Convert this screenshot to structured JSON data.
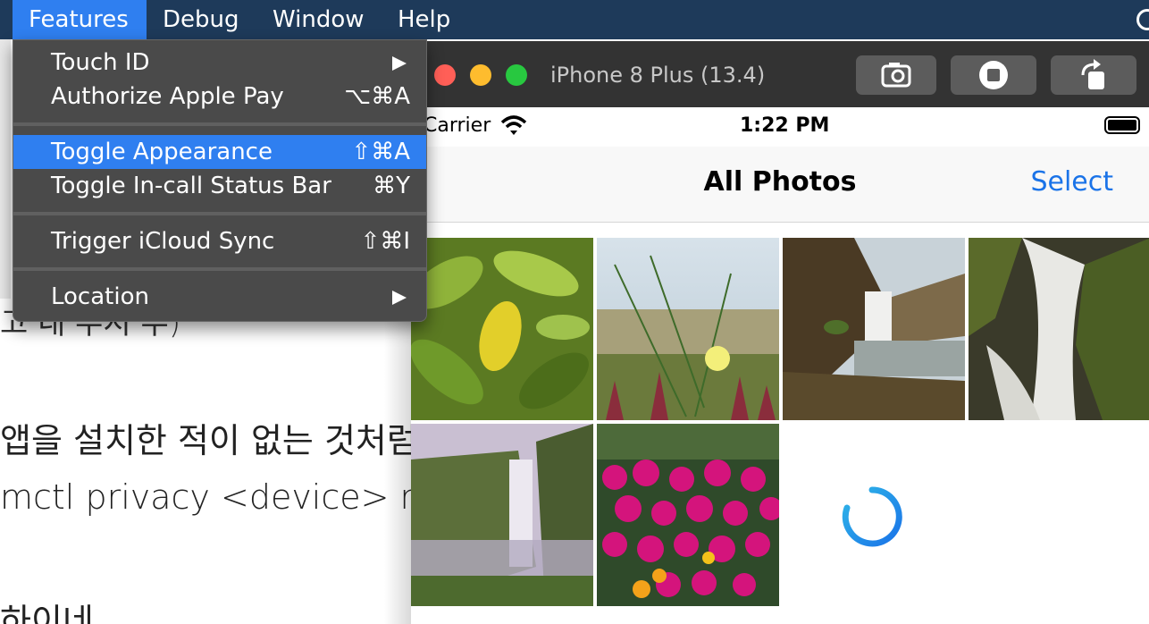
{
  "menubar": {
    "items": [
      "Features",
      "Debug",
      "Window",
      "Help"
    ]
  },
  "features_menu": {
    "items": [
      {
        "label": "Touch ID",
        "shortcut": "",
        "submenu": true
      },
      {
        "label": "Authorize Apple Pay",
        "shortcut": "⌥⌘A",
        "submenu": false
      },
      {
        "label": "Toggle Appearance",
        "shortcut": "⇧⌘A",
        "submenu": false,
        "selected": true
      },
      {
        "label": "Toggle In-call Status Bar",
        "shortcut": "⌘Y",
        "submenu": false
      },
      {
        "label": "Trigger iCloud Sync",
        "shortcut": "⇧⌘I",
        "submenu": false
      },
      {
        "label": "Location",
        "shortcut": "",
        "submenu": true
      }
    ]
  },
  "background_doc": {
    "lines": [
      "고 내 주시 우)",
      "앱을 설치한 적이 없는 것처럼",
      "mctl privacy <device> rese",
      "하이네"
    ]
  },
  "simulator": {
    "title": "iPhone 8 Plus (13.4)",
    "toolbar_icons": [
      "screenshot-icon",
      "home-icon",
      "rotate-icon"
    ],
    "status_bar": {
      "carrier": "Carrier",
      "time": "1:22 PM"
    },
    "nav": {
      "title": "All Photos",
      "select": "Select"
    },
    "photos": [
      "leaves",
      "dune-grass",
      "waterfall-cliff",
      "waterfall-closeup",
      "waterfall-valley",
      "pink-flowers"
    ],
    "loading": true
  },
  "colors": {
    "menubar": "#1e3a5a",
    "highlight": "#2f7ff0",
    "ios_blue": "#1a73e8"
  }
}
